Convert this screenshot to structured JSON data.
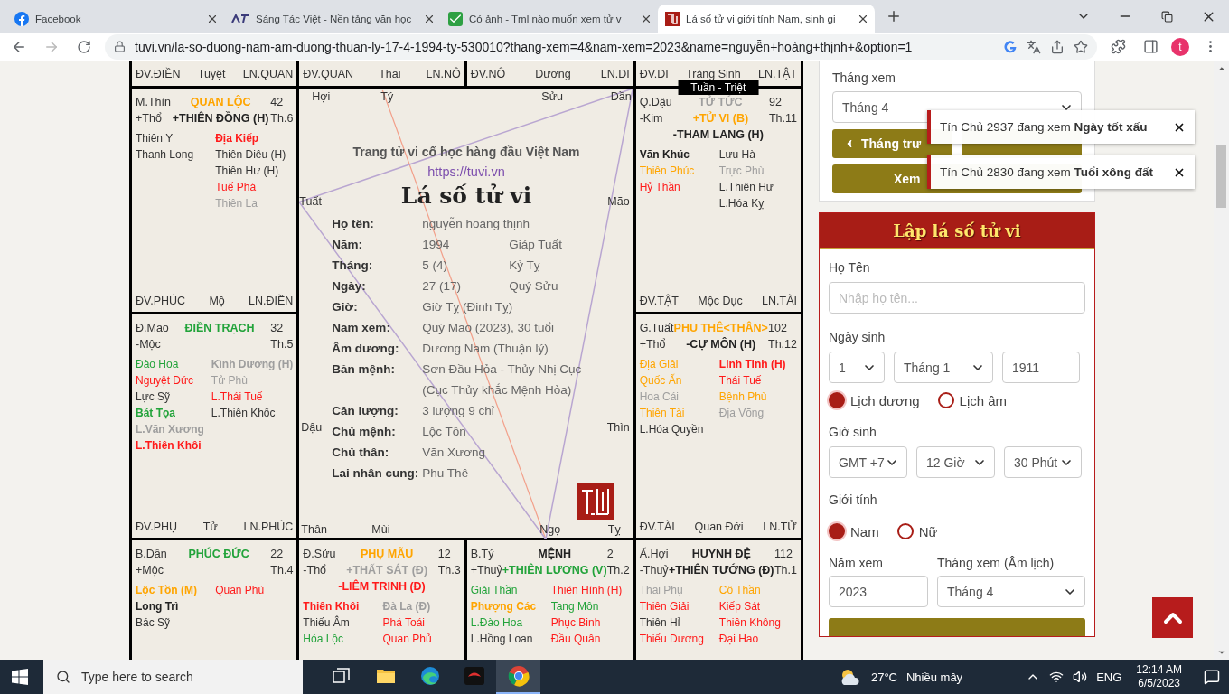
{
  "browser": {
    "tabs": [
      {
        "title": "Facebook",
        "kind": "facebook",
        "selected": false
      },
      {
        "title": "Sáng Tác Việt - Nền tảng văn học",
        "kind": "stv",
        "selected": false
      },
      {
        "title": "Có ảnh - Tml nào muốn xem tử v",
        "kind": "check",
        "selected": false
      },
      {
        "title": "Lá số tử vi giới tính Nam, sinh gi",
        "kind": "seal",
        "selected": true
      }
    ],
    "url": "tuvi.vn/la-so-duong-nam-am-duong-thuan-ly-17-4-1994-ty-530010?thang-xem=4&nam-xem=2023&name=nguyễn+hoàng+thịnh+&option=1",
    "profile": "t"
  },
  "top_row": [
    {
      "left": "ĐV.ĐIỀN",
      "middle": "Tuyệt",
      "right": "LN.QUAN"
    },
    {
      "left": "ĐV.QUAN",
      "middle": "Thai",
      "right": "LN.NÔ"
    },
    {
      "left": "ĐV.NÔ",
      "middle": "Dưỡng",
      "right": "LN.DI"
    },
    {
      "left": "ĐV.DI",
      "middle": "Tràng Sinh",
      "right": "LN.TẬT"
    }
  ],
  "palaces": [
    {
      "stem": "M.Thìn",
      "title": {
        "text": "QUAN LỘC",
        "color": "#ffa500"
      },
      "number": "42",
      "element": "+Thổ",
      "month": "Th.6",
      "main_stars": [
        {
          "name": "+THIÊN ĐỒNG (H)",
          "color": "#222222"
        }
      ],
      "left": [
        {
          "name": "Thiên Y",
          "color": "#333333",
          "bold": false
        },
        {
          "name": "Thanh Long",
          "color": "#333333",
          "bold": false
        }
      ],
      "right": [
        {
          "name": "Địa Kiếp",
          "color": "#ff1a1a",
          "bold": true
        },
        {
          "name": "Thiên Diêu (H)",
          "color": "#333333",
          "bold": false
        },
        {
          "name": "Thiên Hư (H)",
          "color": "#333333",
          "bold": false
        },
        {
          "name": "Tuế Phá",
          "color": "#ff1a1a",
          "bold": false
        },
        {
          "name": "Thiên La",
          "color": "#9e9e9e",
          "bold": false
        }
      ],
      "footer": {
        "left": "ĐV.PHÚC",
        "middle": "Mộ",
        "right": "LN.ĐIỀN"
      }
    },
    {
      "stem": "Q.Dậu",
      "title": {
        "text": "TỬ TỨC",
        "color": "#9e9e9e"
      },
      "number": "92",
      "element": "-Kim",
      "month": "Th.11",
      "badge": "Tuần - Triệt",
      "main_stars": [
        {
          "name": "+TỬ VI (B)",
          "color": "#ffa500"
        },
        {
          "name": "-THAM LANG (H)",
          "color": "#222222"
        }
      ],
      "left": [
        {
          "name": "Văn Khúc",
          "color": "#222222",
          "bold": true
        },
        {
          "name": "Thiên Phúc",
          "color": "#ffa500",
          "bold": false
        },
        {
          "name": "Hỷ Thần",
          "color": "#ff1a1a",
          "bold": false
        }
      ],
      "right": [
        {
          "name": "Lưu Hà",
          "color": "#333333",
          "bold": false
        },
        {
          "name": "Trực Phù",
          "color": "#9e9e9e",
          "bold": false
        },
        {
          "name": "L.Thiên Hư",
          "color": "#333333",
          "bold": false
        },
        {
          "name": "L.Hóa Kỵ",
          "color": "#333333",
          "bold": false
        }
      ],
      "footer": {
        "left": "ĐV.TẬT",
        "middle": "Mộc Dục",
        "right": "LN.TÀI"
      }
    },
    {
      "stem": "Đ.Mão",
      "title": {
        "text": "ĐIỀN TRẠCH",
        "color": "#22a33a"
      },
      "number": "32",
      "element": "-Mộc",
      "month": "Th.5",
      "left": [
        {
          "name": "Đào Hoa",
          "color": "#22a33a",
          "bold": false
        },
        {
          "name": "Nguyệt Đức",
          "color": "#ff1a1a",
          "bold": false
        },
        {
          "name": "Lực Sỹ",
          "color": "#333333",
          "bold": false
        },
        {
          "name": "Bát Tọa",
          "color": "#22a33a",
          "bold": true
        },
        {
          "name": "L.Văn Xương",
          "color": "#9e9e9e",
          "bold": true
        },
        {
          "name": "L.Thiên Khôi",
          "color": "#ff1a1a",
          "bold": true
        }
      ],
      "right": [
        {
          "name": "Kình Dương (H)",
          "color": "#9e9e9e",
          "bold": true
        },
        {
          "name": "Tử Phù",
          "color": "#9e9e9e",
          "bold": false
        },
        {
          "name": "L.Thái Tuế",
          "color": "#ff1a1a",
          "bold": false
        },
        {
          "name": "L.Thiên Khốc",
          "color": "#333333",
          "bold": false
        }
      ],
      "footer": {
        "left": "ĐV.PHỤ",
        "middle": "Tử",
        "right": "LN.PHÚC"
      }
    },
    {
      "stem": "G.Tuất",
      "title": {
        "text": "PHU THÊ<THÂN>",
        "color": "#ffa500"
      },
      "number": "102",
      "element": "+Thổ",
      "month": "Th.12",
      "main_stars": [
        {
          "name": "-CỰ MÔN (H)",
          "color": "#222222"
        }
      ],
      "left": [
        {
          "name": "Địa Giải",
          "color": "#ffa500",
          "bold": false
        },
        {
          "name": "Quốc Ấn",
          "color": "#ffa500",
          "bold": false
        },
        {
          "name": "Hoa Cái",
          "color": "#9e9e9e",
          "bold": false
        },
        {
          "name": "Thiên Tài",
          "color": "#ffa500",
          "bold": false
        },
        {
          "name": "L.Hóa Quyền",
          "color": "#333333",
          "bold": false
        }
      ],
      "right": [
        {
          "name": "Linh Tinh (H)",
          "color": "#ff1a1a",
          "bold": true
        },
        {
          "name": "Thái Tuế",
          "color": "#ff1a1a",
          "bold": false
        },
        {
          "name": "Bệnh Phù",
          "color": "#ffa500",
          "bold": false
        },
        {
          "name": "Địa Võng",
          "color": "#9e9e9e",
          "bold": false
        }
      ],
      "footer": {
        "left": "ĐV.TÀI",
        "middle": "Quan Đới",
        "right": "LN.TỬ"
      }
    },
    {
      "stem": "B.Dần",
      "title": {
        "text": "PHÚC ĐỨC",
        "color": "#22a33a"
      },
      "number": "22",
      "element": "+Mộc",
      "month": "Th.4",
      "left": [
        {
          "name": "Lộc Tồn (M)",
          "color": "#ffa500",
          "bold": true
        },
        {
          "name": "Long Trì",
          "color": "#222222",
          "bold": true
        },
        {
          "name": "Bác Sỹ",
          "color": "#333333",
          "bold": false
        }
      ],
      "right": [
        {
          "name": "Quan Phù",
          "color": "#ff1a1a",
          "bold": false
        }
      ]
    },
    {
      "stem": "Đ.Sửu",
      "title": {
        "text": "PHỤ MẪU",
        "color": "#ffa500"
      },
      "number": "12",
      "element": "-Thổ",
      "month": "Th.3",
      "main_stars": [
        {
          "name": "+THẤT SÁT (Đ)",
          "color": "#9e9e9e"
        },
        {
          "name": "-LIÊM TRINH (Đ)",
          "color": "#ff1a1a"
        }
      ],
      "left": [
        {
          "name": "Thiên Khôi",
          "color": "#ff1a1a",
          "bold": true
        },
        {
          "name": "Thiếu Âm",
          "color": "#333333",
          "bold": false
        },
        {
          "name": "Hóa Lộc",
          "color": "#22a33a",
          "bold": false
        }
      ],
      "right": [
        {
          "name": "Đà La (Đ)",
          "color": "#9e9e9e",
          "bold": true
        },
        {
          "name": "Phá Toái",
          "color": "#ff1a1a",
          "bold": false
        },
        {
          "name": "Quan Phủ",
          "color": "#ff1a1a",
          "bold": false
        }
      ]
    },
    {
      "stem": "B.Tý",
      "title": {
        "text": "MỆNH",
        "color": "#222222"
      },
      "number": "2",
      "element": "+Thuỷ",
      "month": "Th.2",
      "main_stars": [
        {
          "name": "+THIÊN LƯƠNG (V)",
          "color": "#22a33a"
        }
      ],
      "left": [
        {
          "name": "Giải Thần",
          "color": "#22a33a",
          "bold": false
        },
        {
          "name": "Phượng Các",
          "color": "#ffa500",
          "bold": true
        },
        {
          "name": "L.Đào Hoa",
          "color": "#22a33a",
          "bold": false
        },
        {
          "name": "L.Hồng Loan",
          "color": "#333333",
          "bold": false
        }
      ],
      "right": [
        {
          "name": "Thiên Hình (H)",
          "color": "#ff1a1a",
          "bold": false
        },
        {
          "name": "Tang Môn",
          "color": "#22a33a",
          "bold": false
        },
        {
          "name": "Phục Binh",
          "color": "#ff1a1a",
          "bold": false
        },
        {
          "name": "Đầu Quân",
          "color": "#ff1a1a",
          "bold": false
        }
      ]
    },
    {
      "stem": "Ấ.Hợi",
      "title": {
        "text": "HUYNH ĐỆ",
        "color": "#222222"
      },
      "number": "112",
      "element": "-Thuỷ",
      "month": "Th.1",
      "main_stars": [
        {
          "name": "+THIÊN TƯỚNG (Đ)",
          "color": "#222222"
        }
      ],
      "left": [
        {
          "name": "Thai Phụ",
          "color": "#9e9e9e",
          "bold": false
        },
        {
          "name": "Thiên Giải",
          "color": "#ff1a1a",
          "bold": false
        },
        {
          "name": "Thiên Hỉ",
          "color": "#333333",
          "bold": false
        },
        {
          "name": "Thiếu Dương",
          "color": "#ff1a1a",
          "bold": false
        }
      ],
      "right": [
        {
          "name": "Cô Thần",
          "color": "#ffa500",
          "bold": false
        },
        {
          "name": "Kiếp Sát",
          "color": "#ff1a1a",
          "bold": false
        },
        {
          "name": "Thiên Không",
          "color": "#ff1a1a",
          "bold": false
        },
        {
          "name": "Đại Hao",
          "color": "#ff1a1a",
          "bold": false
        }
      ]
    }
  ],
  "center": {
    "branches": [
      "Hợi",
      "Tý",
      "Sửu",
      "Dần",
      "Tuất",
      "Mão",
      "Dậu",
      "Thìn",
      "Thân",
      "Mùi",
      "Ngọ",
      "Tỵ"
    ],
    "tagline": "Trang tử vi cố học hàng đầu Việt Nam",
    "link": "https://tuvi.vn",
    "heading": "Lá số tử vi",
    "info": [
      {
        "label": "Họ tên:",
        "value": "nguyễn hoàng thịnh"
      },
      {
        "label": "Năm:",
        "value": "1994",
        "extra": "Giáp Tuất"
      },
      {
        "label": "Tháng:",
        "value": "5 (4)",
        "extra": "Kỷ Tỵ"
      },
      {
        "label": "Ngày:",
        "value": "27 (17)",
        "extra": "Quý Sửu"
      },
      {
        "label": "Giờ:",
        "value": "Giờ Tỵ (Đinh Tỵ)"
      },
      {
        "label": "Năm xem:",
        "value": "Quý Mão (2023), 30 tuổi"
      },
      {
        "label": "Âm dương:",
        "value": "Dương Nam (Thuận lý)"
      },
      {
        "label": "Bản mệnh:",
        "value": "Sơn Đầu Hỏa - Thủy Nhị Cục",
        "note": "(Cục Thủy khắc Mệnh Hỏa)"
      },
      {
        "label": "Cân lượng:",
        "value": "3 lượng 9 chỉ"
      },
      {
        "label": "Chủ mệnh:",
        "value": "Lộc Tồn"
      },
      {
        "label": "Chủ thân:",
        "value": "Văn Xương"
      },
      {
        "label": "Lai nhân cung:",
        "value": "Phu Thê"
      }
    ]
  },
  "side": {
    "month_view": {
      "label": "Tháng xem",
      "select": "Tháng 4",
      "prev_button": "Tháng trư",
      "view_button": "Xem"
    },
    "form": {
      "title": "Lập lá số tử vi",
      "name_label": "Họ Tên",
      "name_placeholder": "Nhập họ tên...",
      "birth_label": "Ngày sinh",
      "day": "1",
      "month": "Tháng 1",
      "year": "1911",
      "calendar": [
        {
          "label": "Lịch dương",
          "selected": true
        },
        {
          "label": "Lịch âm",
          "selected": false
        }
      ],
      "hour_label": "Giờ sinh",
      "timezone": "GMT +7",
      "hour": "12 Giờ",
      "minute": "30 Phút",
      "gender_label": "Giới tính",
      "gender": [
        {
          "label": "Nam",
          "selected": true
        },
        {
          "label": "Nữ",
          "selected": false
        }
      ],
      "year_view_label": "Năm xem",
      "year_view": "2023",
      "month_view_label": "Tháng xem (Âm lịch)",
      "month_view": "Tháng 4"
    }
  },
  "notifications": [
    {
      "text": "Tín Chủ 2937 đang xem **Ngày tốt xấu**"
    },
    {
      "text": "Tín Chủ 2830 đang xem **Tuổi xông đất**"
    }
  ],
  "taskbar": {
    "search_placeholder": "Type here to search",
    "apps": [
      {
        "kind": "task-view",
        "running": false
      },
      {
        "kind": "folder",
        "running": false
      },
      {
        "kind": "edge",
        "running": false
      },
      {
        "kind": "game",
        "running": false
      },
      {
        "kind": "chrome",
        "running": true
      }
    ],
    "temperature": "27°C",
    "weather": "Nhiều mây",
    "language": "ENG",
    "time": "12:14 AM",
    "date": "6/5/2023"
  }
}
